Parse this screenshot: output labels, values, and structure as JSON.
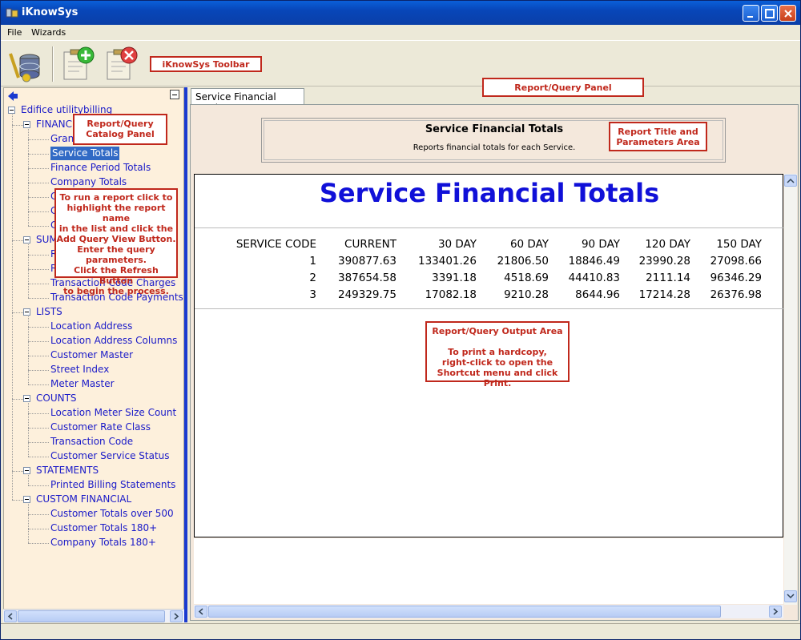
{
  "window": {
    "title": "iKnowSys"
  },
  "menu": [
    "File",
    "Wizards"
  ],
  "callouts": {
    "toolbar": "iKnowSys Toolbar",
    "report_panel": "Report/Query Panel",
    "catalog_panel": [
      "Report/Query",
      "Catalog Panel"
    ],
    "title_area": [
      "Report Title and",
      "Parameters Area"
    ],
    "instructions": [
      "To run a report click to",
      "highlight the report name",
      "in the list and click the",
      "Add Query View Button.",
      "Enter the query",
      "parameters.",
      "Click the Refresh Button",
      "to begin the process."
    ],
    "output_area": [
      "Report/Query Output Area",
      "",
      "To print a hardcopy,",
      "right-click to open the",
      "Shortcut menu and click Print."
    ]
  },
  "tree": {
    "root": "Edifice utilitybilling",
    "groups": [
      {
        "label": "FINANCIAL",
        "items": [
          "Grand Totals",
          "Service Totals",
          "Finance Period Totals",
          "Company Totals",
          "C",
          "C",
          "C"
        ]
      },
      {
        "label": "SUMMARY",
        "items": [
          "R",
          "R",
          "Transaction Code Charges",
          "Transaction Code Payments"
        ]
      },
      {
        "label": "LISTS",
        "items": [
          "Location Address",
          "Location Address Columns",
          "Customer Master",
          "Street Index",
          "Meter Master"
        ]
      },
      {
        "label": "COUNTS",
        "items": [
          "Location Meter Size Count",
          "Customer Rate Class",
          "Transaction Code",
          "Customer Service Status"
        ]
      },
      {
        "label": "STATEMENTS",
        "items": [
          "Printed Billing Statements"
        ]
      },
      {
        "label": "CUSTOM FINANCIAL",
        "items": [
          "Customer Totals over 500",
          "Customer Totals 180+",
          "Company Totals 180+"
        ]
      }
    ]
  },
  "tab": {
    "label": "Service Financial Totals"
  },
  "report_header": {
    "title": "Service Financial Totals",
    "description": "Reports financial totals for each Service."
  },
  "report": {
    "title": "Service Financial Totals",
    "columns": [
      "SERVICE CODE",
      "CURRENT",
      "30 DAY",
      "60 DAY",
      "90 DAY",
      "120 DAY",
      "150 DAY"
    ],
    "rows": [
      [
        "1",
        "390877.63",
        "133401.26",
        "21806.50",
        "18846.49",
        "23990.28",
        "27098.66"
      ],
      [
        "2",
        "387654.58",
        "3391.18",
        "4518.69",
        "44410.83",
        "2111.14",
        "96346.29"
      ],
      [
        "3",
        "249329.75",
        "17082.18",
        "9210.28",
        "8644.96",
        "17214.28",
        "26376.98"
      ]
    ]
  },
  "colors": {
    "title_blue": "#1010d8",
    "callout_red": "#c0281c",
    "tree_link": "#1a1ac8",
    "selection": "#316ac5",
    "panel_bg": "#fdf0dc"
  }
}
